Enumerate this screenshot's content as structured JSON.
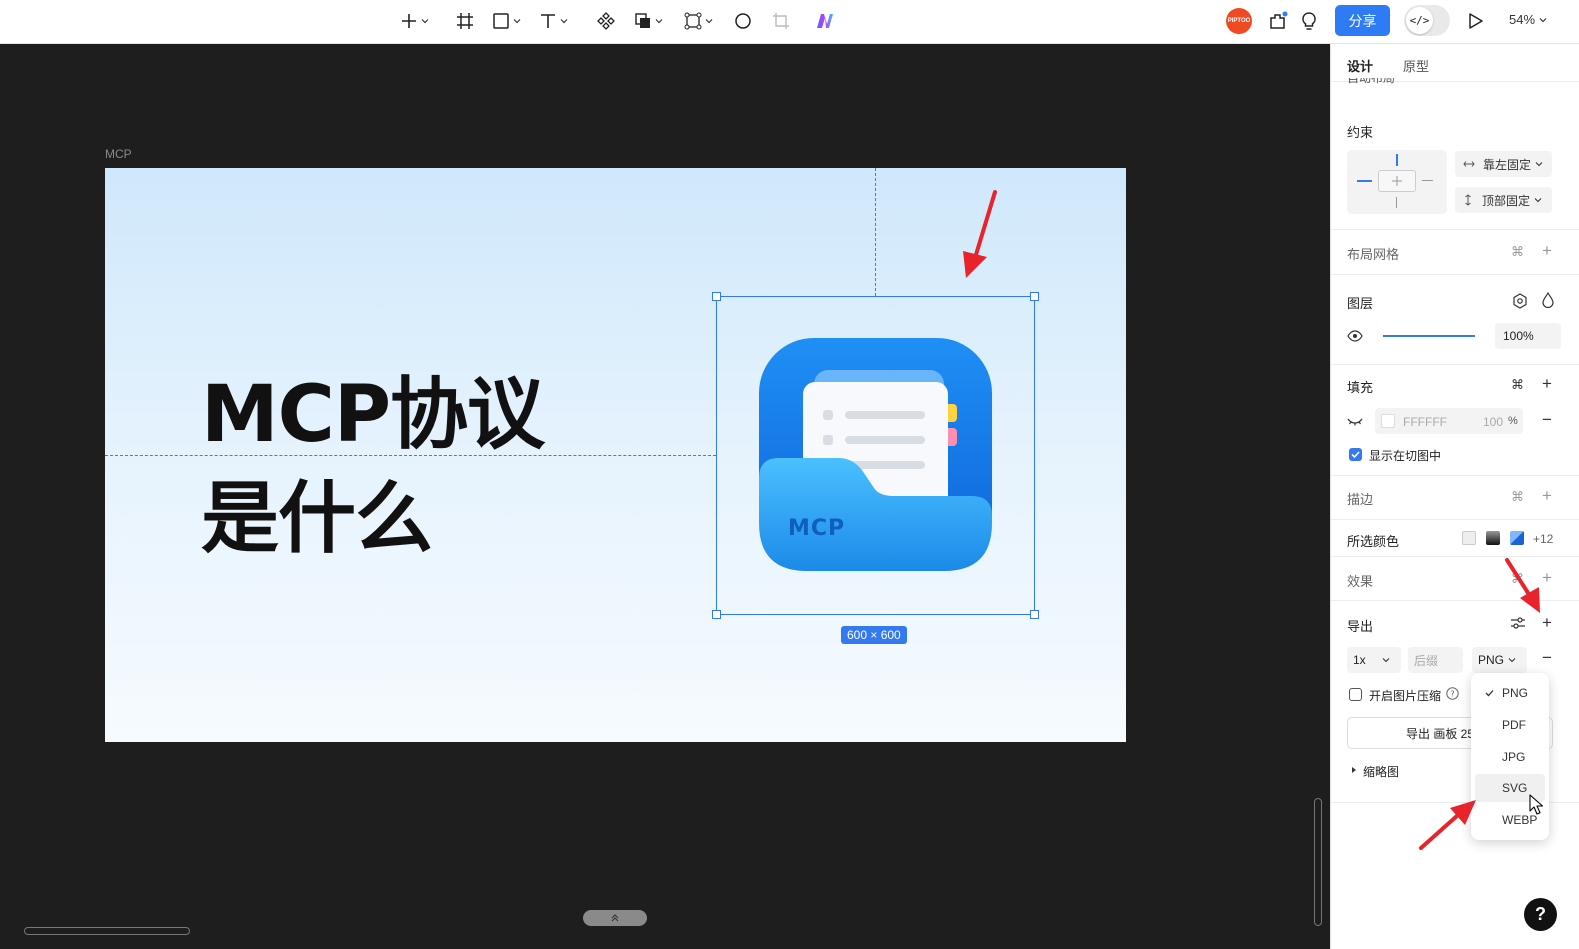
{
  "toolbar": {
    "avatar_text": "PIPTOO",
    "share_label": "分享",
    "code_toggle_symbol": "</>",
    "zoom_label": "54%",
    "tools": [
      "add-icon",
      "frame-icon",
      "rectangle-icon",
      "text-icon",
      "component-icon",
      "boolean-icon",
      "vector-network-icon",
      "ellipse-icon",
      "crop-icon",
      "ai-logo-icon"
    ]
  },
  "canvas": {
    "frame_label": "MCP",
    "headline_line1": "MCP协议",
    "headline_line2": "是什么",
    "folder_label": "MCP",
    "size_badge": "600 × 600"
  },
  "panel": {
    "tabs": [
      "设计",
      "原型"
    ],
    "auto_layout_label": "自动布局",
    "constraints": {
      "title": "约束",
      "horizontal": "靠左固定",
      "vertical": "顶部固定"
    },
    "layout_grid": "布局网格",
    "layer": {
      "title": "图层",
      "opacity": "100%"
    },
    "fill": {
      "title": "填充",
      "hex": "FFFFFF",
      "opacity": "100",
      "opacity_unit": "%",
      "show_in_export": "显示在切图中"
    },
    "stroke": "描边",
    "selected_colors": {
      "title": "所选颜色",
      "more": "+12"
    },
    "effects": "效果",
    "export": {
      "title": "导出",
      "scale": "1x",
      "suffix_placeholder": "后缀",
      "format": "PNG",
      "compress_label": "开启图片压缩",
      "export_button": "导出 画板 25",
      "thumbnail": "缩略图"
    },
    "format_menu": [
      "PNG",
      "PDF",
      "JPG",
      "SVG",
      "WEBP"
    ],
    "format_menu_selected": "PNG",
    "format_menu_hover": "SVG"
  },
  "help_label": "?",
  "colors": {
    "accent": "#2d7cf6",
    "annotation_arrow": "#e8232b",
    "canvas_bg": "#1e1e1e"
  }
}
